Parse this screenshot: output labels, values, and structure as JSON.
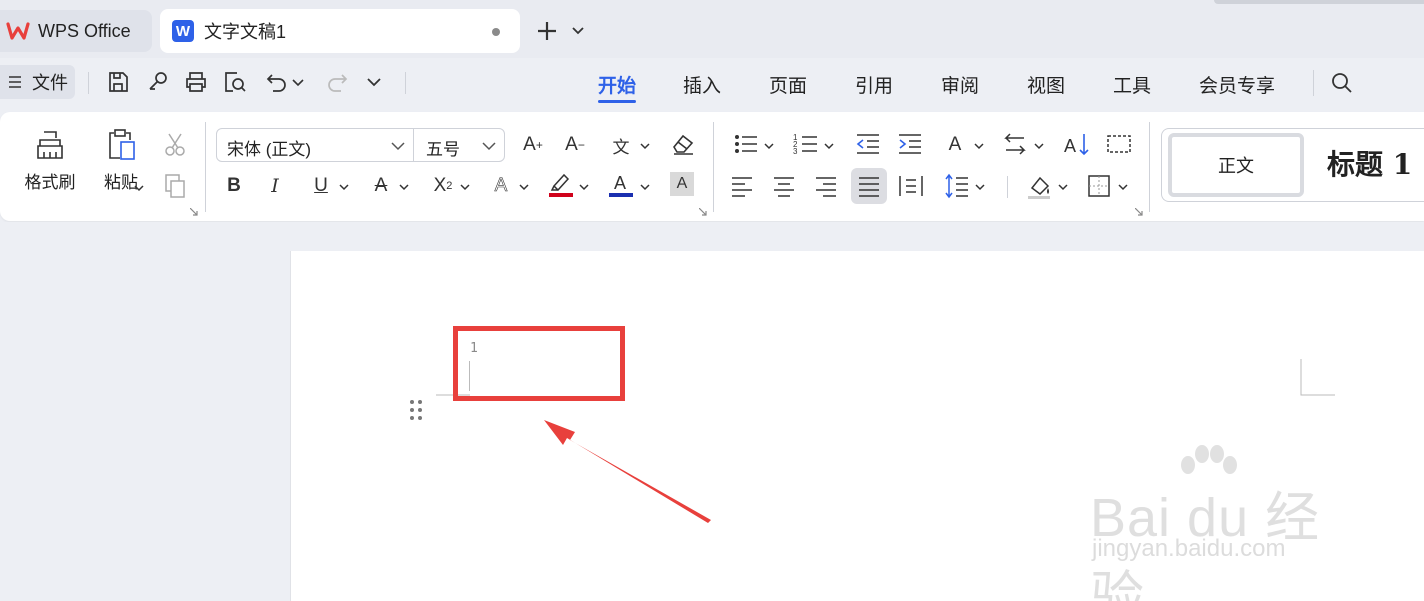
{
  "tabs": {
    "home_label": "WPS Office",
    "doc_title": "文字文稿1",
    "doc_icon_letter": "W"
  },
  "menu": {
    "file_label": "文件",
    "tabs": [
      "开始",
      "插入",
      "页面",
      "引用",
      "审阅",
      "视图",
      "工具",
      "会员专享"
    ],
    "active_tab": "开始"
  },
  "ribbon": {
    "format_painter": "格式刷",
    "paste": "粘贴",
    "font_name": "宋体 (正文)",
    "font_size": "五号",
    "style_normal": "正文",
    "style_heading": "标题 1"
  },
  "document": {
    "line_number": "1"
  },
  "watermark": {
    "brand": "Bai du 经验",
    "url": "jingyan.baidu.com"
  },
  "colors": {
    "accent": "#2e61e8",
    "highlight": "#e8403c",
    "font_color_bar": "#1a2fb0",
    "highlight_color_bar": "#d0021b"
  }
}
